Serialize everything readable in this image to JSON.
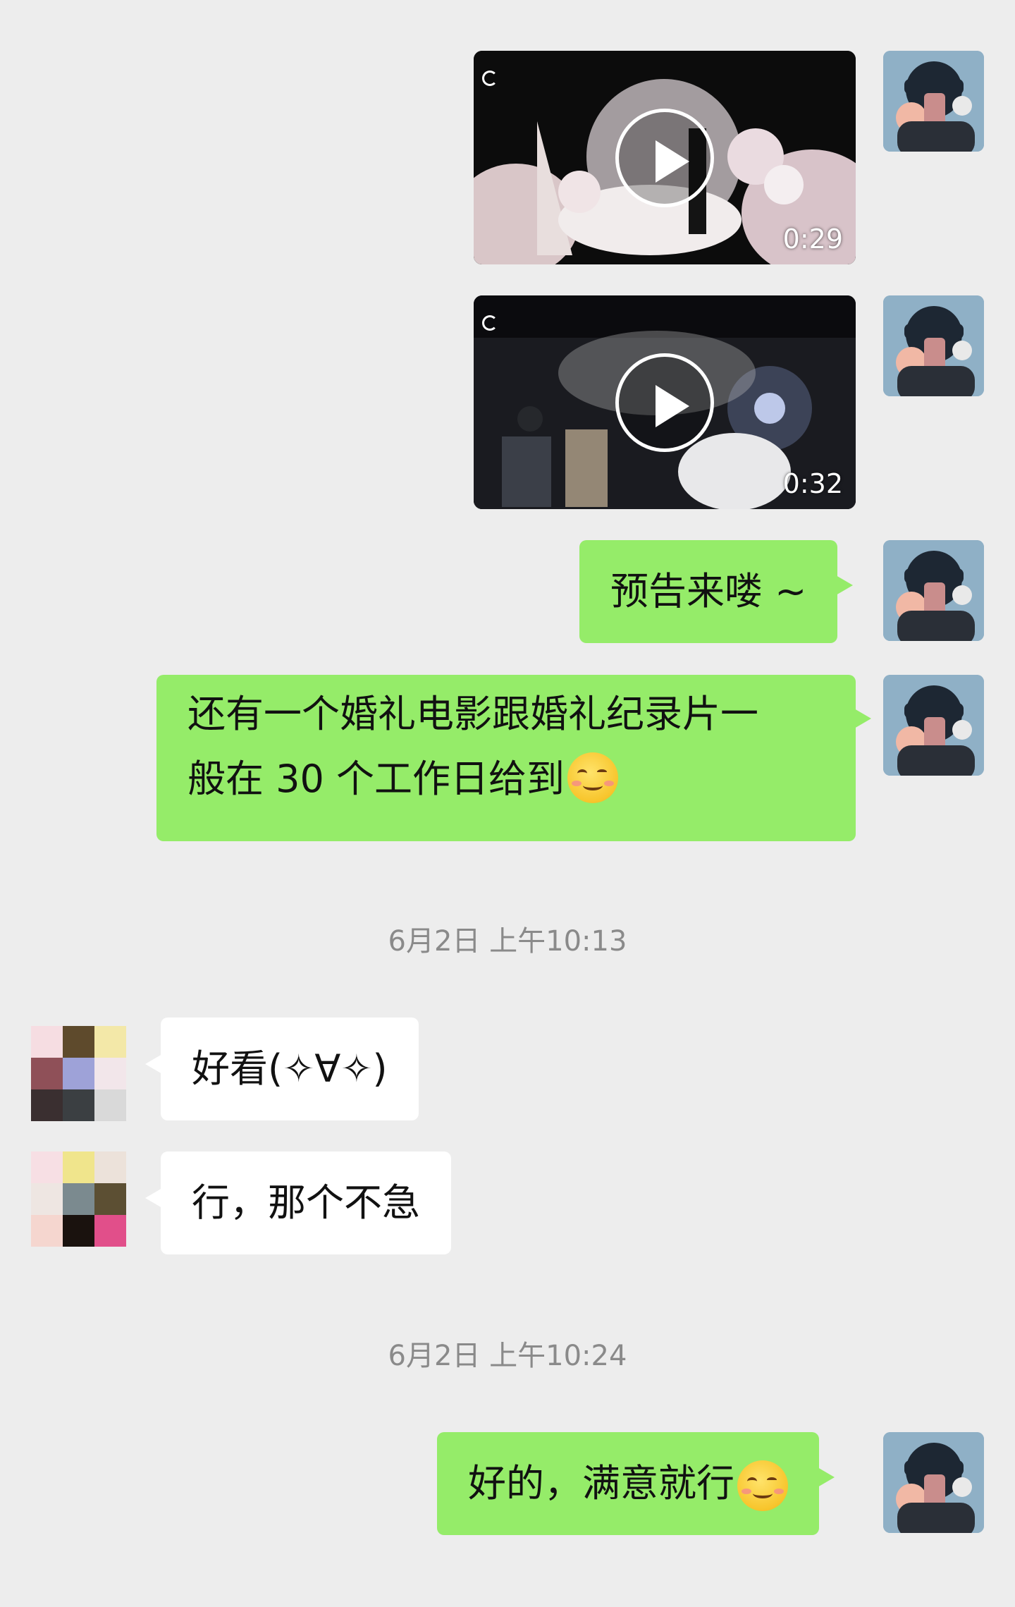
{
  "messages": {
    "video1": {
      "duration": "0:29"
    },
    "video2": {
      "duration": "0:32"
    },
    "msg1": {
      "text": "预告来喽 ~"
    },
    "msg2": {
      "line1": "还有一个婚礼电影跟婚礼纪录片一",
      "line2": "般在 30 个工作日给到"
    },
    "ts1": {
      "text": "6月2日 上午10:13"
    },
    "reply1": {
      "text": "好看(✧∀✧)"
    },
    "reply2": {
      "text": "行，那个不急"
    },
    "ts2": {
      "text": "6月2日 上午10:24"
    },
    "msg3": {
      "text": "好的，满意就行"
    }
  },
  "colors": {
    "background": "#ededed",
    "me_bubble": "#95ec69",
    "other_bubble": "#ffffff",
    "timestamp": "#8a8a8a"
  },
  "icons": {
    "play": "play-icon",
    "emoji": "smile-blush-emoji"
  }
}
